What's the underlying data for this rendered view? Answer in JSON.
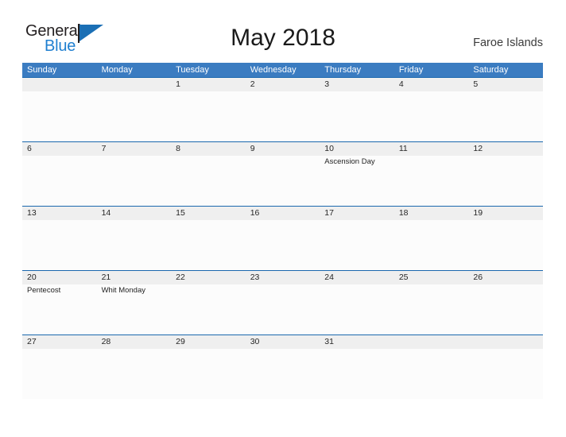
{
  "brand": {
    "name_part1": "General",
    "name_part2": "Blue",
    "flag_icon": "triangle-flag-icon",
    "colors": {
      "dark": "#231f20",
      "blue": "#1f7fd0",
      "flag_blue": "#1b6fb5"
    }
  },
  "header": {
    "title": "May 2018",
    "locale": "Faroe Islands"
  },
  "calendar": {
    "colors": {
      "header_bar": "#3b7cc1",
      "week_rule": "#1b68ae",
      "date_band": "#efefef",
      "cell_body": "#fcfcfc"
    },
    "day_headers": [
      "Sunday",
      "Monday",
      "Tuesday",
      "Wednesday",
      "Thursday",
      "Friday",
      "Saturday"
    ],
    "weeks": [
      {
        "dates": [
          "",
          "",
          "1",
          "2",
          "3",
          "4",
          "5"
        ],
        "events": [
          "",
          "",
          "",
          "",
          "",
          "",
          ""
        ]
      },
      {
        "dates": [
          "6",
          "7",
          "8",
          "9",
          "10",
          "11",
          "12"
        ],
        "events": [
          "",
          "",
          "",
          "",
          "Ascension Day",
          "",
          ""
        ]
      },
      {
        "dates": [
          "13",
          "14",
          "15",
          "16",
          "17",
          "18",
          "19"
        ],
        "events": [
          "",
          "",
          "",
          "",
          "",
          "",
          ""
        ]
      },
      {
        "dates": [
          "20",
          "21",
          "22",
          "23",
          "24",
          "25",
          "26"
        ],
        "events": [
          "Pentecost",
          "Whit Monday",
          "",
          "",
          "",
          "",
          ""
        ]
      },
      {
        "dates": [
          "27",
          "28",
          "29",
          "30",
          "31",
          "",
          ""
        ],
        "events": [
          "",
          "",
          "",
          "",
          "",
          "",
          ""
        ]
      }
    ]
  }
}
